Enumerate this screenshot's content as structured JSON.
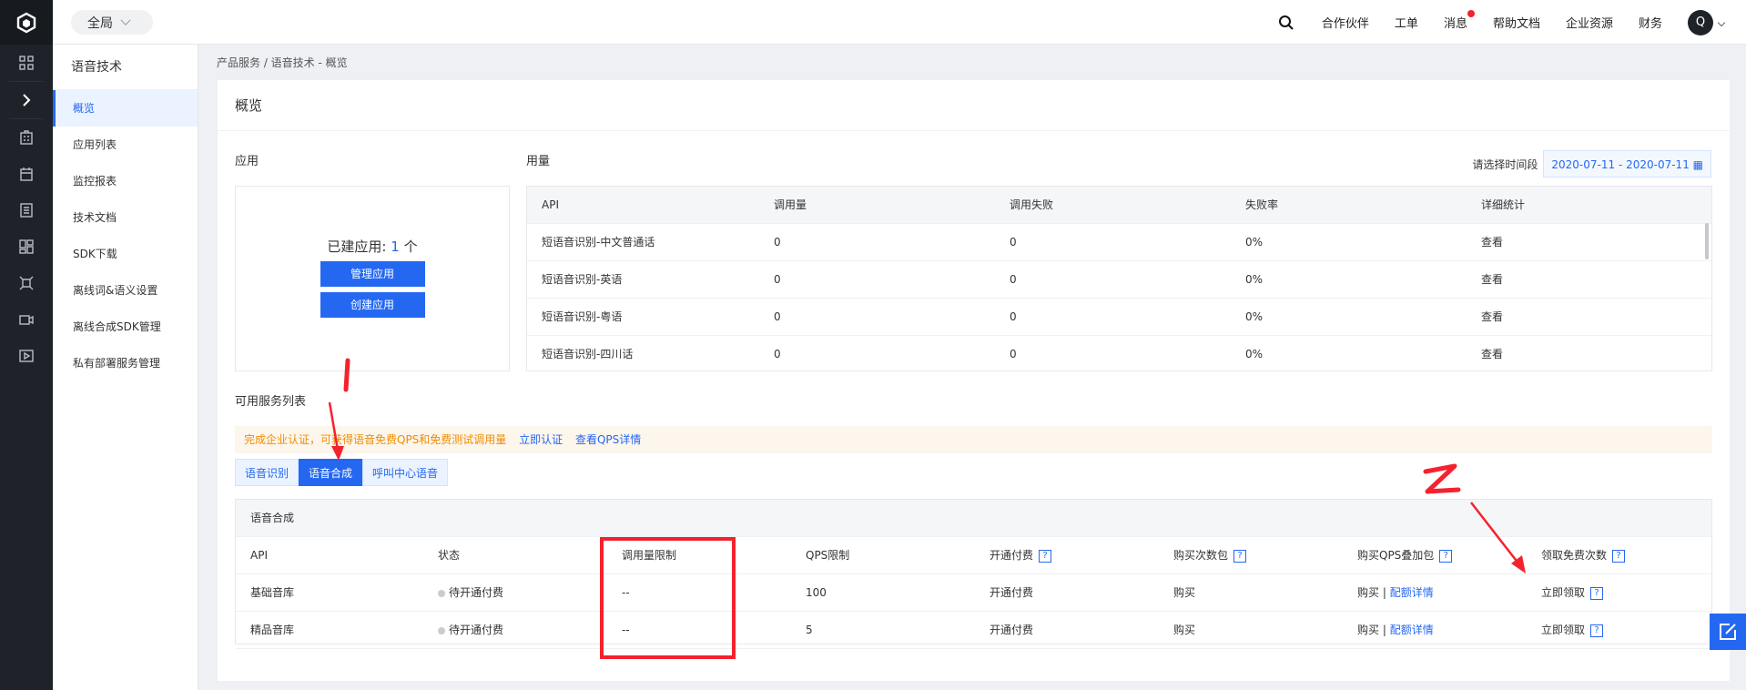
{
  "topbar": {
    "scope_label": "全局",
    "nav": [
      "合作伙伴",
      "工单",
      "消息",
      "帮助文档",
      "企业资源",
      "财务"
    ],
    "avatar_letter": "Q"
  },
  "sidebar": {
    "title": "语音技术",
    "items": [
      {
        "label": "概览"
      },
      {
        "label": "应用列表"
      },
      {
        "label": "监控报表"
      },
      {
        "label": "技术文档"
      },
      {
        "label": "SDK下载"
      },
      {
        "label": "离线词&语义设置"
      },
      {
        "label": "离线合成SDK管理"
      },
      {
        "label": "私有部署服务管理"
      }
    ]
  },
  "breadcrumb": "产品服务 / 语音技术 - 概览",
  "panel": {
    "title": "概览",
    "app_section": "应用",
    "usage_section": "用量",
    "app_count_label": "已建应用: ",
    "app_count": "1",
    "app_count_unit": " 个",
    "manage_btn": "管理应用",
    "create_btn": "创建应用",
    "date_label": "请选择时间段",
    "date_range": "2020-07-11 - 2020-07-11"
  },
  "usage_table": {
    "headers": [
      "API",
      "调用量",
      "调用失败",
      "失败率",
      "详细统计"
    ],
    "rows": [
      {
        "api": "短语音识别-中文普通话",
        "calls": "0",
        "fails": "0",
        "rate": "0%",
        "detail": "查看"
      },
      {
        "api": "短语音识别-英语",
        "calls": "0",
        "fails": "0",
        "rate": "0%",
        "detail": "查看"
      },
      {
        "api": "短语音识别-粤语",
        "calls": "0",
        "fails": "0",
        "rate": "0%",
        "detail": "查看"
      },
      {
        "api": "短语音识别-四川话",
        "calls": "0",
        "fails": "0",
        "rate": "0%",
        "detail": "查看"
      }
    ]
  },
  "services": {
    "section": "可用服务列表",
    "notice": "完成企业认证，可获得语音免费QPS和免费测试调用量",
    "notice_link1": "立即认证",
    "notice_link2": "查看QPS详情",
    "tabs": [
      {
        "label": "语音识别"
      },
      {
        "label": "语音合成"
      },
      {
        "label": "呼叫中心语音"
      }
    ],
    "group_title": "语音合成",
    "headers": [
      "API",
      "状态",
      "调用量限制",
      "QPS限制",
      "开通付费",
      "购买次数包",
      "购买QPS叠加包",
      "领取免费次数"
    ],
    "rows": [
      {
        "api": "基础音库",
        "status": "待开通付费",
        "limit": "--",
        "qps": "100",
        "pay": "开通付费",
        "buy": "购买",
        "qps_buy": "购买",
        "qps_detail": "配额详情",
        "free": "立即领取"
      },
      {
        "api": "精品音库",
        "status": "待开通付费",
        "limit": "--",
        "qps": "5",
        "pay": "开通付费",
        "buy": "购买",
        "qps_buy": "购买",
        "qps_detail": "配额详情",
        "free": "立即领取"
      }
    ]
  },
  "colors": {
    "accent": "#2468f2",
    "annotation": "#f5222d",
    "warning": "#f08c00"
  }
}
